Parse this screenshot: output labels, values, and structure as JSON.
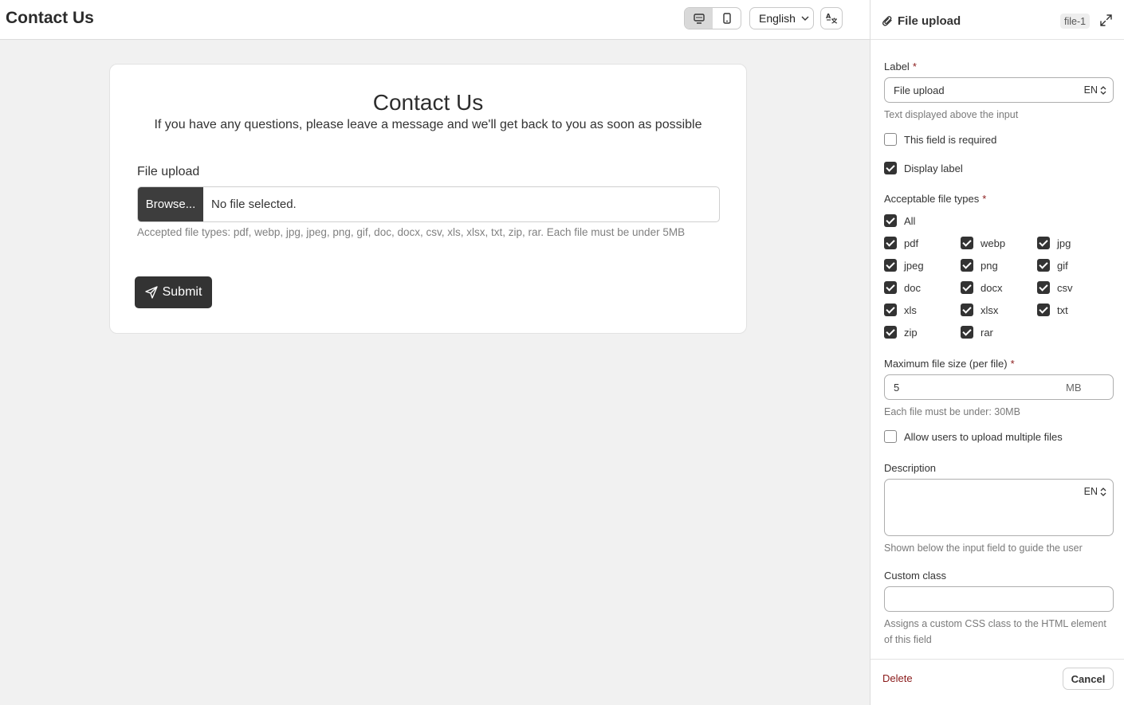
{
  "header": {
    "title": "Contact Us",
    "language": "English"
  },
  "form": {
    "title": "Contact Us",
    "subtitle": "If you have any questions, please leave a message and we'll get back to you as soon as possible",
    "field_label": "File upload",
    "browse_label": "Browse...",
    "file_status": "No file selected.",
    "help_text": "Accepted file types: pdf, webp, jpg, jpeg, png, gif, doc, docx, csv, xls, xlsx, txt, zip, rar. Each file must be under 5MB",
    "submit_label": "Submit"
  },
  "panel": {
    "title": "File upload",
    "badge": "file-1",
    "label_heading": "Label",
    "label_value": "File upload",
    "lang_code": "EN",
    "label_hint": "Text displayed above the input",
    "required_label": "This field is required",
    "required_checked": false,
    "display_label": "Display label",
    "display_label_checked": true,
    "file_types_heading": "Acceptable file types",
    "all_label": "All",
    "all_checked": true,
    "file_types": [
      {
        "name": "pdf",
        "checked": true
      },
      {
        "name": "webp",
        "checked": true
      },
      {
        "name": "jpg",
        "checked": true
      },
      {
        "name": "jpeg",
        "checked": true
      },
      {
        "name": "png",
        "checked": true
      },
      {
        "name": "gif",
        "checked": true
      },
      {
        "name": "doc",
        "checked": true
      },
      {
        "name": "docx",
        "checked": true
      },
      {
        "name": "csv",
        "checked": true
      },
      {
        "name": "xls",
        "checked": true
      },
      {
        "name": "xlsx",
        "checked": true
      },
      {
        "name": "txt",
        "checked": true
      },
      {
        "name": "zip",
        "checked": true
      },
      {
        "name": "rar",
        "checked": true
      }
    ],
    "max_size_heading": "Maximum file size (per file)",
    "max_size_value": "5",
    "max_size_unit": "MB",
    "max_size_hint": "Each file must be under: 30MB",
    "multiple_label": "Allow users to upload multiple files",
    "multiple_checked": false,
    "description_heading": "Description",
    "description_value": "",
    "description_hint": "Shown below the input field to guide the user",
    "custom_class_heading": "Custom class",
    "custom_class_value": "",
    "custom_class_hint": "Assigns a custom CSS class to the HTML element of this field",
    "delete_label": "Delete",
    "cancel_label": "Cancel"
  }
}
